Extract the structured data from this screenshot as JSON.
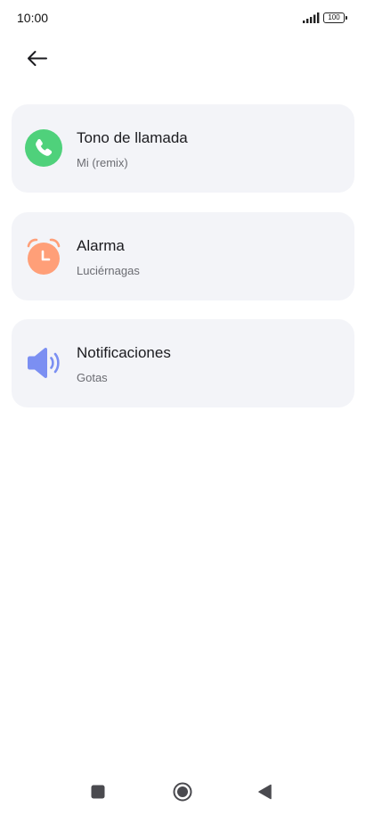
{
  "status_bar": {
    "time": "10:00",
    "battery_level": "100",
    "signal_icon": "signal-bars-icon",
    "battery_icon": "battery-icon"
  },
  "toolbar": {
    "back_icon": "arrow-left-icon"
  },
  "sound_items": [
    {
      "title": "Tono de llamada",
      "subtitle": "Mi (remix)",
      "icon": "phone-icon",
      "icon_color": "#4fd17b"
    },
    {
      "title": "Alarma",
      "subtitle": "Luciérnagas",
      "icon": "alarm-clock-icon",
      "icon_color": "#ff9f78"
    },
    {
      "title": "Notificaciones",
      "subtitle": "Gotas",
      "icon": "speaker-icon",
      "icon_color": "#7b8ff2"
    }
  ],
  "nav_bar": {
    "recents_icon": "square-icon",
    "home_icon": "circle-home-icon",
    "back_icon": "triangle-back-icon"
  }
}
